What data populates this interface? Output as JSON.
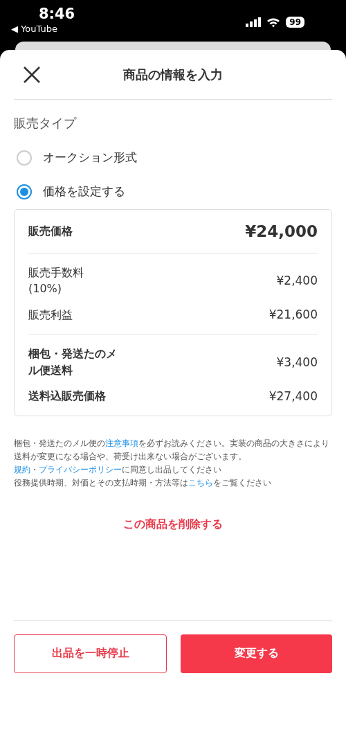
{
  "status_bar": {
    "time": "8:46",
    "back_app": "◀ YouTube",
    "battery": "99"
  },
  "header": {
    "title": "商品の情報を入力"
  },
  "sale_type": {
    "label": "販売タイプ",
    "options": [
      {
        "label": "オークション形式",
        "selected": false
      },
      {
        "label": "価格を設定する",
        "selected": true
      }
    ]
  },
  "price_card": {
    "sections": [
      [
        {
          "label": "販売価格",
          "value": "¥24,000",
          "kind": "main"
        }
      ],
      [
        {
          "label": "販売手数料\n(10%)",
          "value": "¥2,400",
          "kind": "plain"
        },
        {
          "label": "販売利益",
          "value": "¥21,600",
          "kind": "plain"
        }
      ],
      [
        {
          "label": "梱包・発送たのメル便送料",
          "value": "¥3,400",
          "kind": "bold"
        },
        {
          "label": "送料込販売価格",
          "value": "¥27,400",
          "kind": "bold"
        }
      ]
    ]
  },
  "notes": [
    [
      {
        "text": "梱包・発送たのメル便の",
        "kind": "text"
      },
      {
        "text": "注意事項",
        "kind": "link"
      },
      {
        "text": "を必ずお読みください。実装の商品の大きさにより送料が変更になる場合や、荷受け出来ない場合がございます。",
        "kind": "text"
      }
    ],
    [
      {
        "text": "規約",
        "kind": "link"
      },
      {
        "text": "・",
        "kind": "text"
      },
      {
        "text": "プライバシーポリシー",
        "kind": "link"
      },
      {
        "text": "に同意し出品してください",
        "kind": "text"
      }
    ],
    [
      {
        "text": "役務提供時期、対価とその支払時期・方法等は",
        "kind": "text"
      },
      {
        "text": "こちら",
        "kind": "link"
      },
      {
        "text": "をご覧ください",
        "kind": "text"
      }
    ]
  ],
  "delete_link": "この商品を削除する",
  "buttons": [
    {
      "label": "出品を一時停止",
      "kind": "outline"
    },
    {
      "label": "変更する",
      "kind": "filled"
    }
  ]
}
